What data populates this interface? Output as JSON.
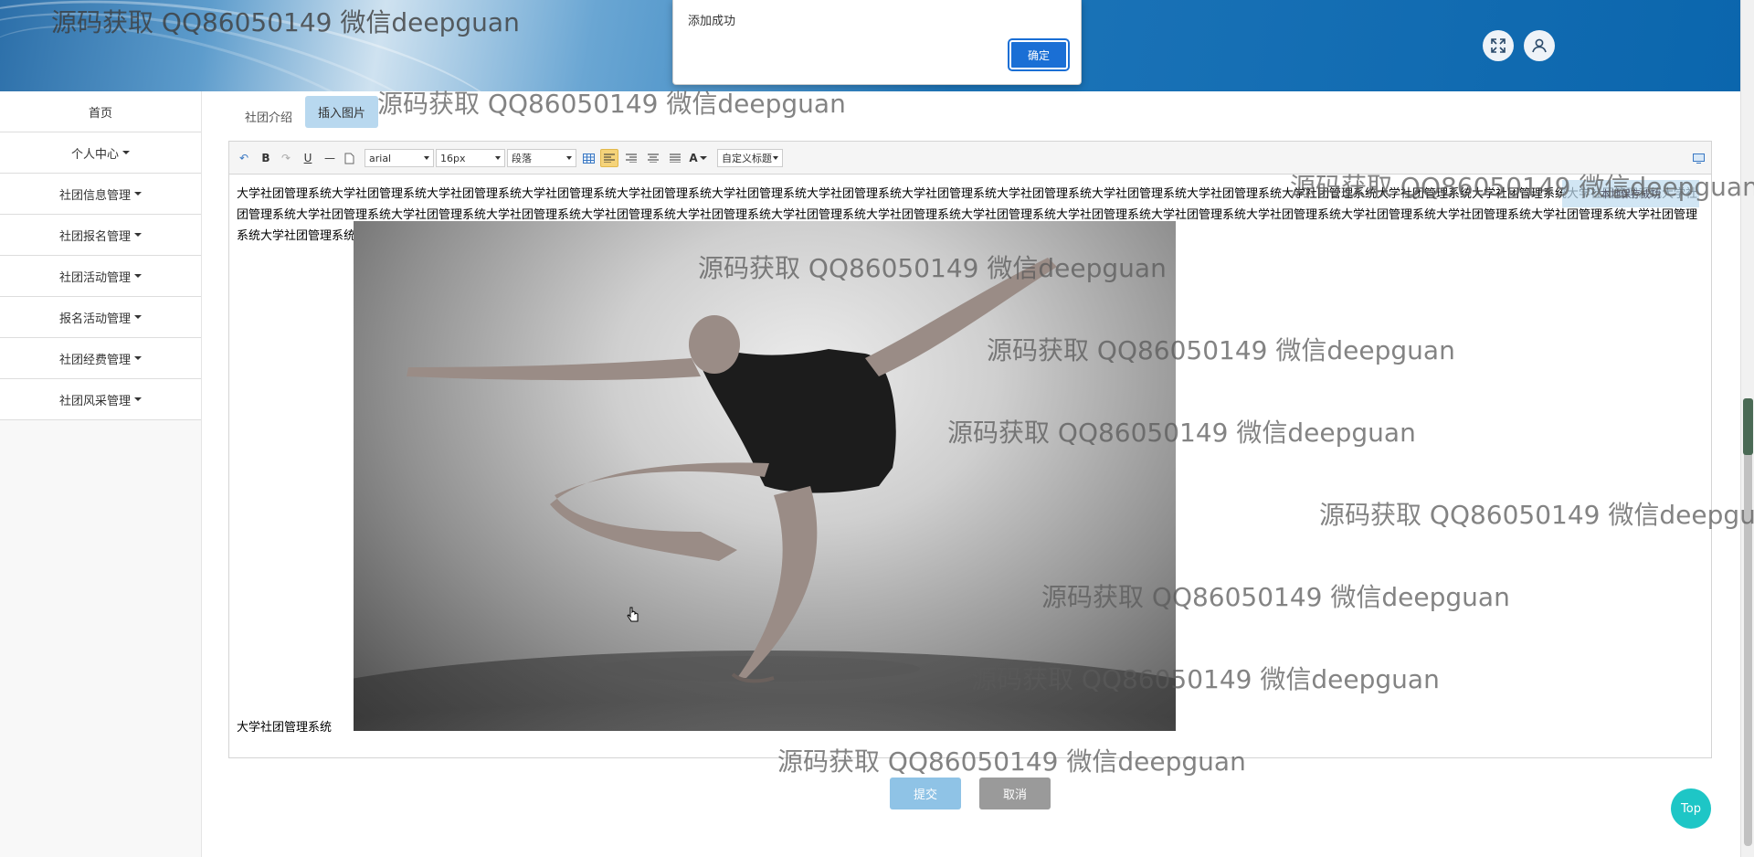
{
  "header": {
    "fullscreen_icon": "expand-icon",
    "user_icon": "user-icon"
  },
  "alert": {
    "message": "添加成功",
    "ok_label": "确定"
  },
  "sidebar": {
    "items": [
      {
        "label": "首页",
        "dropdown": false
      },
      {
        "label": "个人中心",
        "dropdown": true
      },
      {
        "label": "社团信息管理",
        "dropdown": true
      },
      {
        "label": "社团报名管理",
        "dropdown": true
      },
      {
        "label": "社团活动管理",
        "dropdown": true
      },
      {
        "label": "报名活动管理",
        "dropdown": true
      },
      {
        "label": "社团经费管理",
        "dropdown": true
      },
      {
        "label": "社团风采管理",
        "dropdown": true
      }
    ]
  },
  "form": {
    "field_label": "社团介绍",
    "insert_image_label": "插入图片",
    "submit_label": "提交",
    "cancel_label": "取消"
  },
  "editor": {
    "font_family": "arial",
    "font_size": "16px",
    "paragraph": "段落",
    "custom_heading": "自定义标题",
    "text_color_icon": "A",
    "content_text": "大学社团管理系统大学社团管理系统大学社团管理系统大学社团管理系统大学社团管理系统大学社团管理系统大学社团管理系统大学社团管理系统大学社团管理系统大学社团管理系统大学社团管理系统大学社团管理系统大学社团管理系统大学社团管理系统大学社团管理系统大学社团管理系统大学社团管理系统大学社团管理系统大学社团管理系统大学社团管理系统大学社团管理系统大学社团管理系统大学社团管理系统大学社团管理系统大学社团管理系统大学社团管理系统大学社团管理系统大学社团管理系统大学社团管理系统大学社团管理系统大学社团管理系统大学社团管理系统",
    "bottom_text": "大学社团管理系统",
    "floating_note": "本地保存成功"
  },
  "top_button": "Top",
  "watermark": "源码获取 QQ86050149 微信deepguan"
}
